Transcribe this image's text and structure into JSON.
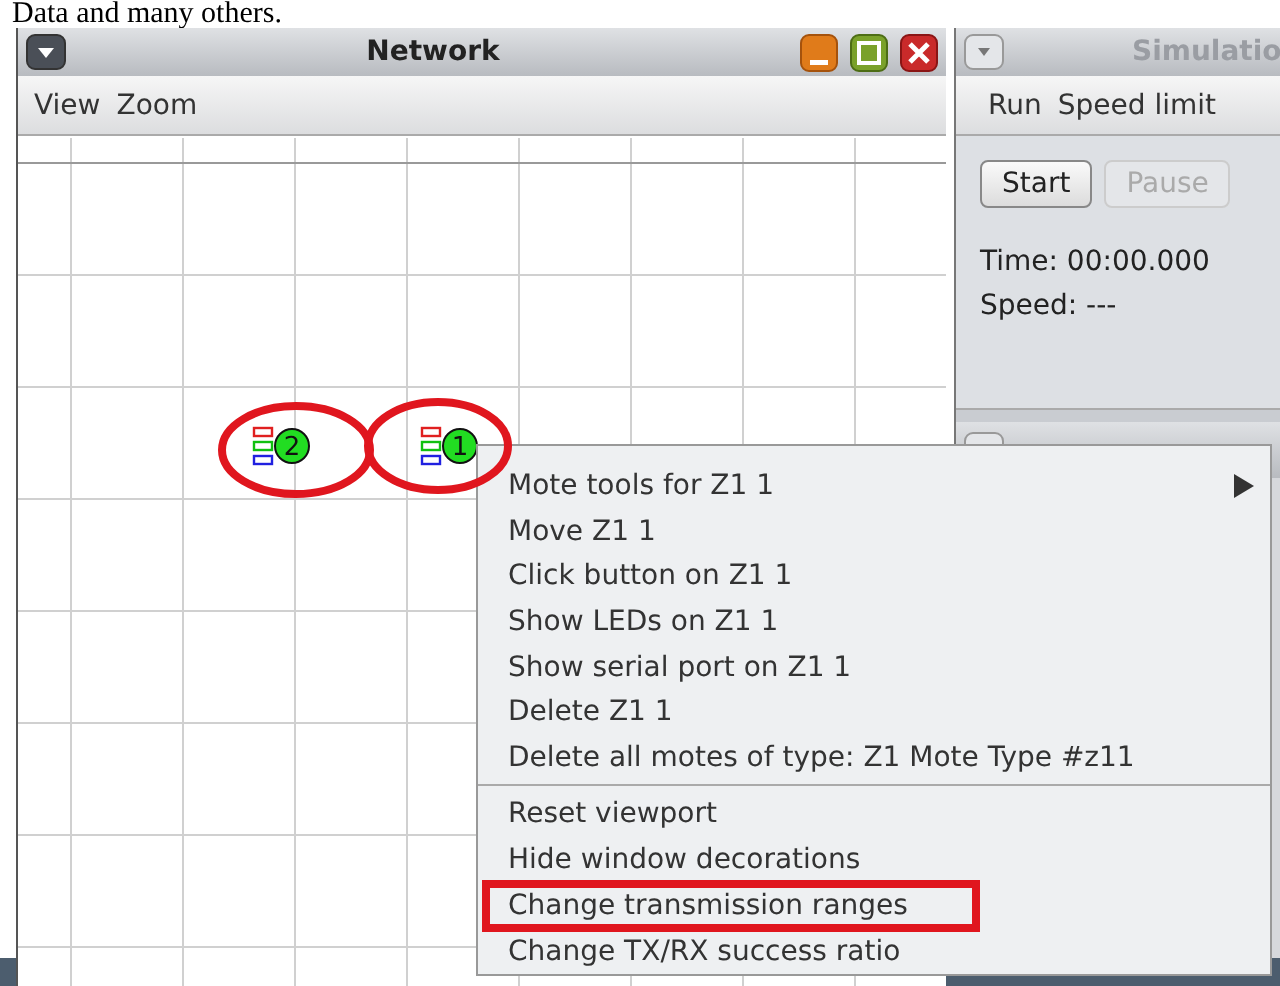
{
  "caption": "Data and many others.",
  "network_window": {
    "title": "Network",
    "menu": [
      "View",
      "Zoom"
    ],
    "motes": [
      {
        "label": "2",
        "annotated": true
      },
      {
        "label": "1",
        "annotated": true
      }
    ]
  },
  "simulation_window": {
    "title": "Simulatio",
    "menu": [
      "Run",
      "Speed limit"
    ],
    "buttons": [
      {
        "label": "Start",
        "disabled": false
      },
      {
        "label": "Pause",
        "disabled": true
      }
    ],
    "time": "Time: 00:00.000",
    "speed": "Speed: ---"
  },
  "context_menu": {
    "items": [
      {
        "label": "Mote tools for Z1 1",
        "submenu": true,
        "separator_before": false,
        "annotated": false
      },
      {
        "label": "Move Z1 1",
        "submenu": false,
        "separator_before": false,
        "annotated": false
      },
      {
        "label": "Click button on Z1 1",
        "submenu": false,
        "separator_before": false,
        "annotated": false
      },
      {
        "label": "Show LEDs on Z1 1",
        "submenu": false,
        "separator_before": false,
        "annotated": false
      },
      {
        "label": "Show serial port on Z1 1",
        "submenu": false,
        "separator_before": false,
        "annotated": false
      },
      {
        "label": "Delete Z1 1",
        "submenu": false,
        "separator_before": false,
        "annotated": false
      },
      {
        "label": "Delete all motes of type: Z1 Mote Type #z11",
        "submenu": false,
        "separator_before": false,
        "annotated": false
      },
      {
        "label": "Reset viewport",
        "submenu": false,
        "separator_before": true,
        "annotated": false
      },
      {
        "label": "Hide window decorations",
        "submenu": false,
        "separator_before": false,
        "annotated": false
      },
      {
        "label": "Change transmission ranges",
        "submenu": false,
        "separator_before": false,
        "annotated": true
      },
      {
        "label": "Change TX/RX success ratio",
        "submenu": false,
        "separator_before": false,
        "annotated": false
      }
    ]
  }
}
